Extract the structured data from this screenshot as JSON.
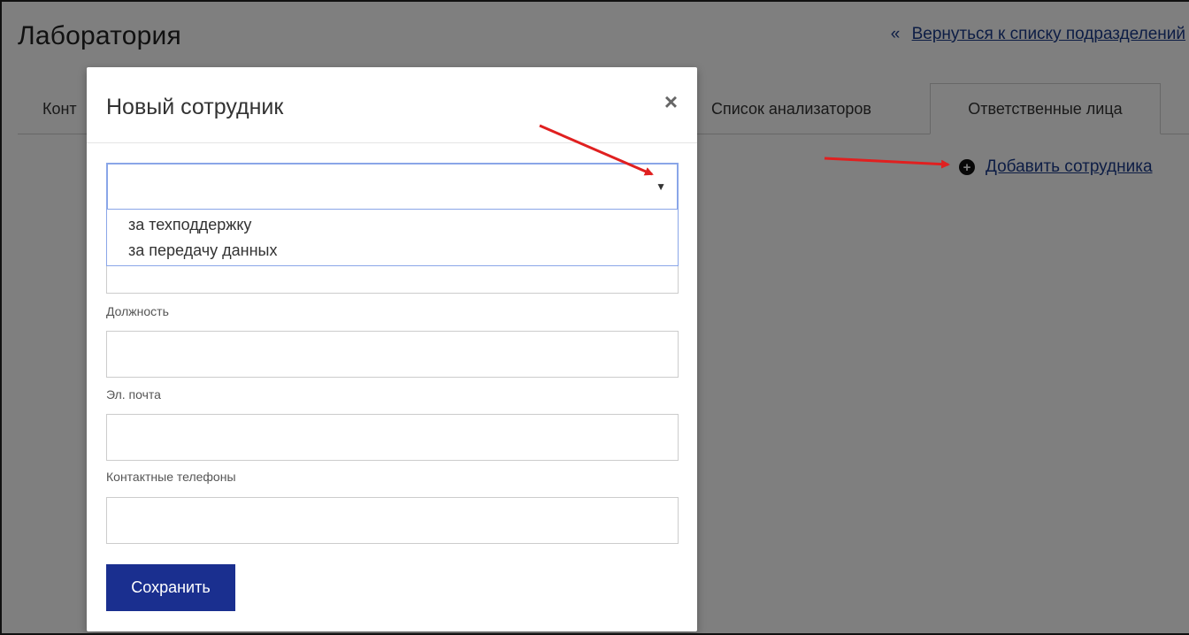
{
  "page": {
    "title": "Лаборатория",
    "back_chevron": "«",
    "back_link": "Вернуться к списку подразделений"
  },
  "tabs": [
    {
      "label": "Конт"
    },
    {
      "label": "Список анализаторов"
    },
    {
      "label": "Ответственные лица",
      "active": true
    }
  ],
  "actions": {
    "add_icon": "plus-circle-icon",
    "add_glyph": "+",
    "add_label": "Добавить сотрудника"
  },
  "modal": {
    "title": "Новый сотрудник",
    "close_glyph": "×",
    "select": {
      "value": "",
      "arrow_glyph": "▼",
      "options": [
        "за техподдержку",
        "за передачу данных"
      ]
    },
    "fields": [
      {
        "label": "Должность",
        "value": ""
      },
      {
        "label": "Эл. почта",
        "value": ""
      },
      {
        "label": "Контактные телефоны",
        "value": ""
      }
    ],
    "save_label": "Сохранить"
  },
  "colors": {
    "link": "#1a3a8a",
    "button": "#1a2f8f",
    "annotation_arrow": "#e02020",
    "focus_border": "#8aa6e8"
  }
}
